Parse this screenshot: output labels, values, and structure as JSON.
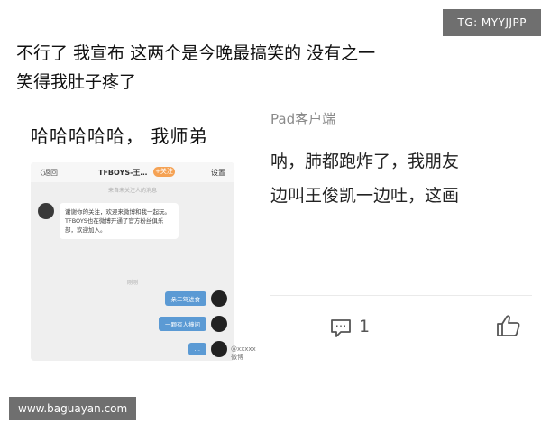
{
  "watermarks": {
    "tg": "TG: MYYJJPP",
    "site": "www.baguayan.com"
  },
  "post": {
    "line1": "不行了 我宣布  这两个是今晚最搞笑的  没有之一",
    "line2": "笑得我肚子疼了"
  },
  "left_screenshot": {
    "handwriting": "哈哈哈哈哈，  我师弟",
    "header": {
      "back": "〈返回",
      "title": "TFBOYS-王…",
      "badge": "+关注",
      "settings": "设置"
    },
    "subline": "来自未关注人的消息",
    "incoming_message": "谢谢你的关注，欢迎来微博和我一起玩。TFBOYS也在微博开通了官方粉丝俱乐部，欢迎加入。",
    "timestamp": "刚刚",
    "outgoing_messages": [
      "朵二驾进食",
      "一颗有人撞问",
      "…"
    ],
    "image_watermark": "@xxxxx微博"
  },
  "right_screenshot": {
    "client_label": "Pad客户端",
    "reply_line1": "呐，肺都跑炸了，我朋友",
    "reply_line2": "边叫王俊凯一边吐，这画",
    "comment_count": "1",
    "icons": {
      "comment": "comment-icon",
      "like": "thumbs-up-icon"
    }
  },
  "colors": {
    "bubble_out": "#5b9ad4",
    "badge": "#f5a254",
    "watermark_bg": "#6f6f6f"
  }
}
